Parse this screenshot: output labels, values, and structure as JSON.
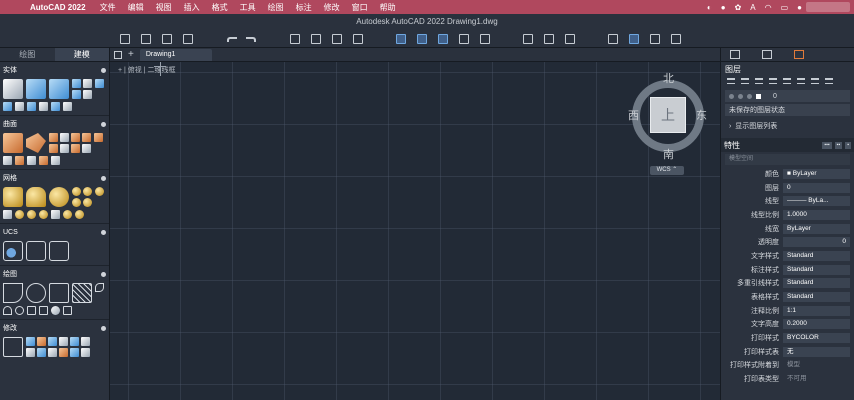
{
  "menubar": {
    "app_name": "AutoCAD 2022",
    "items": [
      "文件",
      "编辑",
      "视图",
      "插入",
      "格式",
      "工具",
      "绘图",
      "标注",
      "修改",
      "窗口",
      "帮助"
    ]
  },
  "window": {
    "title": "Autodesk AutoCAD 2022   Drawing1.dwg"
  },
  "left_panel": {
    "tabs": [
      "绘图",
      "建模"
    ],
    "active_tab": "建模",
    "sections": [
      "实体",
      "曲面",
      "网格",
      "UCS",
      "绘图",
      "修改"
    ]
  },
  "drawing": {
    "tab_label": "Drawing1",
    "view_label": "[-][俯视][二维线框]",
    "view_label_display": "+  | 俯视 | 二维线框"
  },
  "viewcube": {
    "face": "上",
    "north": "北",
    "south": "南",
    "east": "东",
    "west": "西",
    "wcs": "WCS ⌃"
  },
  "right_panel": {
    "layers_title": "图层",
    "layer_value": "0",
    "layer_state": "未保存的图层状态",
    "show_layer_list": "显示图层列表",
    "properties_title": "特性",
    "properties_select": "模型空间",
    "properties": [
      {
        "label": "颜色",
        "value": "■ ByLayer"
      },
      {
        "label": "图层",
        "value": "0"
      },
      {
        "label": "线型",
        "value": "——— ByLa..."
      },
      {
        "label": "线型比例",
        "value": "1.0000"
      },
      {
        "label": "线宽",
        "value": "ByLayer"
      },
      {
        "label": "透明度",
        "value": "0"
      },
      {
        "label": "文字样式",
        "value": "Standard"
      },
      {
        "label": "标注样式",
        "value": "Standard"
      },
      {
        "label": "多重引线样式",
        "value": "Standard"
      },
      {
        "label": "表格样式",
        "value": "Standard"
      },
      {
        "label": "注释比例",
        "value": "1:1"
      },
      {
        "label": "文字高度",
        "value": "0.2000"
      },
      {
        "label": "打印样式",
        "value": "BYCOLOR"
      },
      {
        "label": "打印样式表",
        "value": "无"
      },
      {
        "label": "打印样式附着到",
        "value": "模型"
      },
      {
        "label": "打印表类型",
        "value": "不可用"
      }
    ]
  }
}
